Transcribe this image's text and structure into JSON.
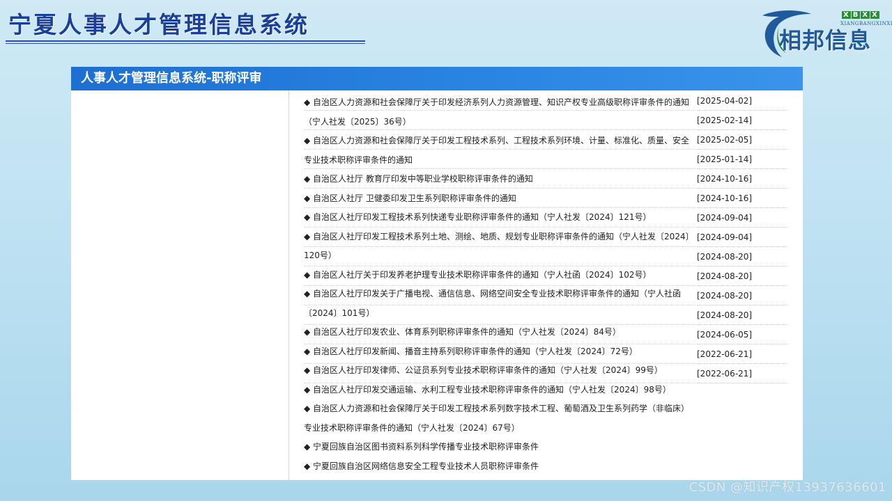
{
  "header": {
    "title": "宁夏人事人才管理信息系统"
  },
  "logo": {
    "badge_letters": [
      "X",
      "B",
      "X",
      "X"
    ],
    "subtitle": "XIANGBANGXINXI",
    "brand": "相邦信息"
  },
  "panel": {
    "title": "人事人才管理信息系统-职称评审"
  },
  "notices": [
    "◆ 自治区人力资源和社会保障厅关于印发经济系列人力资源管理、知识产权专业高级职称评审条件的通知（宁人社发〔2025〕36号）",
    "◆ 自治区人力资源和社会保障厅关于印发工程技术系列、工程技术系列环境、计量、标准化、质量、安全专业技术职称评审条件的通知",
    "◆ 自治区人社厅 教育厅印发中等职业学校职称评审条件的通知",
    "◆ 自治区人社厅 卫健委印发卫生系列职称评审条件的通知",
    "◆ 自治区人社厅印发工程技术系列快递专业职称评审条件的通知（宁人社发〔2024〕121号）",
    "◆ 自治区人社厅印发工程技术系列土地、测绘、地质、规划专业职称评审条件的通知（宁人社发〔2024〕120号）",
    "◆ 自治区人社厅关于印发养老护理专业技术职称评审条件的通知（宁人社函〔2024〕102号）",
    "◆ 自治区人社厅印发关于广播电视、通信信息、网络空间安全专业技术职称评审条件的通知（宁人社函〔2024〕101号）",
    "◆ 自治区人社厅印发农业、体育系列职称评审条件的通知（宁人社发〔2024〕84号）",
    "◆ 自治区人社厅印发新闻、播音主持系列职称评审条件的通知（宁人社发〔2024〕72号）",
    "◆ 自治区人社厅印发律师、公证员系列专业技术职称评审条件的通知（宁人社发〔2024〕99号）",
    "◆ 自治区人社厅印发交通运输、水利工程专业技术职称评审条件的通知（宁人社发〔2024〕98号）",
    "◆ 自治区人力资源和社会保障厅关于印发工程技术系列数字技术工程、葡萄酒及卫生系列药学（非临床）专业技术职称评审条件的通知（宁人社发〔2024〕67号）",
    "◆ 宁夏回族自治区图书资料系列科学传播专业技术职称评审条件",
    "◆ 宁夏回族自治区网络信息安全工程专业技术人员职称评审条件"
  ],
  "dates": [
    "[2025-04-02]",
    "[2025-02-14]",
    "[2025-02-05]",
    "[2025-01-14]",
    "[2024-10-16]",
    "[2024-10-16]",
    "[2024-09-04]",
    "[2024-09-04]",
    "[2024-08-20]",
    "[2024-08-20]",
    "[2024-08-20]",
    "[2024-08-20]",
    "[2024-06-05]",
    "[2022-06-21]",
    "[2022-06-21]"
  ],
  "footer": {
    "watermark": "CSDN @知识产权13937636601"
  }
}
